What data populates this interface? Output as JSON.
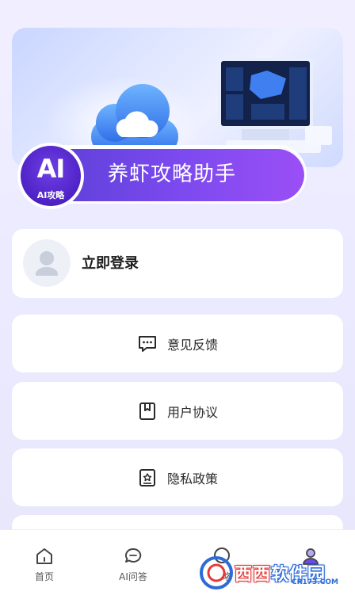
{
  "banner": {
    "title": "养虾攻略助手",
    "badge_text": "AI",
    "badge_sub": "AI攻略"
  },
  "login": {
    "label": "立即登录"
  },
  "menu": [
    {
      "label": "意见反馈",
      "icon": "feedback-icon"
    },
    {
      "label": "用户协议",
      "icon": "bookmark-icon"
    },
    {
      "label": "隐私政策",
      "icon": "privacy-icon"
    }
  ],
  "nav": [
    {
      "label": "首页",
      "icon": "home-icon"
    },
    {
      "label": "AI问答",
      "icon": "chat-icon"
    },
    {
      "label": "攻略",
      "icon": "guide-icon"
    },
    {
      "label": "",
      "icon": "profile-icon"
    }
  ],
  "watermark": {
    "text_a": "西西",
    "text_b": "软件园",
    "sub": "CR173.COM"
  },
  "colors": {
    "accent": "#6a4be3",
    "pill_start": "#5a3fd6",
    "pill_end": "#9a4ff5",
    "background": "#eceaff"
  }
}
